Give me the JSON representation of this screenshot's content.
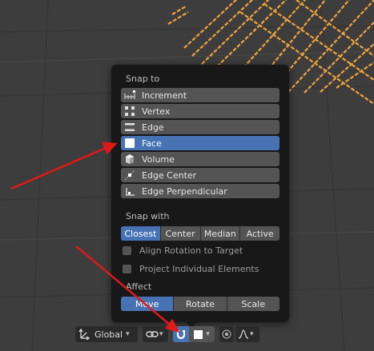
{
  "popup": {
    "snap_to_title": "Snap to",
    "items": [
      {
        "label": "Increment",
        "icon": "increment-icon",
        "selected": false
      },
      {
        "label": "Vertex",
        "icon": "vertex-icon",
        "selected": false
      },
      {
        "label": "Edge",
        "icon": "edge-icon",
        "selected": false
      },
      {
        "label": "Face",
        "icon": "face-icon",
        "selected": true
      },
      {
        "label": "Volume",
        "icon": "volume-icon",
        "selected": false
      },
      {
        "label": "Edge Center",
        "icon": "edge-center-icon",
        "selected": false
      },
      {
        "label": "Edge Perpendicular",
        "icon": "edge-perpendicular-icon",
        "selected": false
      }
    ],
    "snap_with_title": "Snap with",
    "snap_with": [
      {
        "label": "Closest",
        "active": true
      },
      {
        "label": "Center",
        "active": false
      },
      {
        "label": "Median",
        "active": false
      },
      {
        "label": "Active",
        "active": false
      }
    ],
    "align_rotation_label": "Align Rotation to Target",
    "project_individual_label": "Project Individual Elements",
    "affect_title": "Affect",
    "affect": [
      {
        "label": "Move",
        "active": true
      },
      {
        "label": "Rotate",
        "active": false
      },
      {
        "label": "Scale",
        "active": false
      }
    ]
  },
  "toolbar": {
    "orientation_label": "Global",
    "icons": [
      "transform-orientation-icon",
      "pivot-link-icon",
      "snap-magnet-icon",
      "snap-face-icon",
      "proportional-editing-icon",
      "falloff-curve-icon"
    ]
  },
  "colors": {
    "accent": "#4772b3",
    "annotation_arrow": "#e01919",
    "wireframe": "#f2a33a"
  }
}
